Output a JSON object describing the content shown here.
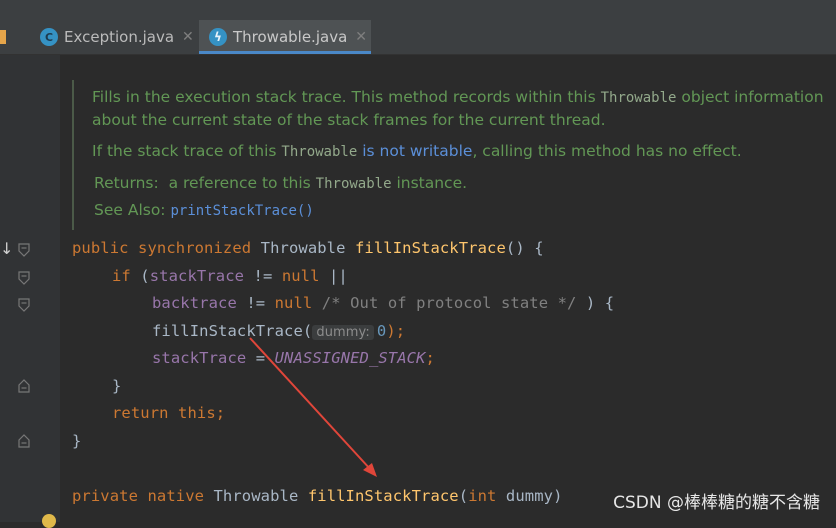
{
  "tabs": [
    {
      "label": "Exception.java",
      "icon": "class-c-icon",
      "active": false
    },
    {
      "label": "Throwable.java",
      "icon": "lightning-icon",
      "active": true
    }
  ],
  "doc": {
    "line1_pre": "Fills in the execution stack trace. This method records within this ",
    "line1_code": "Throwable",
    "line1_post": " object information",
    "line2": "about the current state of the stack frames for the current thread.",
    "line3_pre": "If the stack trace of this ",
    "line3_code": "Throwable",
    "line3_link": "is not writable",
    "line3_post": ", calling this method has no effect.",
    "returns_label": "Returns:",
    "returns_pre": "a reference to this ",
    "returns_code": "Throwable",
    "returns_post": " instance.",
    "seealso_label": "See Also:",
    "seealso_link": "printStackTrace()"
  },
  "code": {
    "l1_kw1": "public",
    "l1_kw2": "synchronized",
    "l1_type": "Throwable",
    "l1_fn": "fillInStackTrace",
    "l1_rest": "() {",
    "l2_kw": "if",
    "l2_a": " (",
    "l2_fld": "stackTrace",
    "l2_op": " != ",
    "l2_null": "null",
    "l2_end": " ||",
    "l3_fld": "backtrace",
    "l3_op": " != ",
    "l3_null": "null",
    "l3_cmt": " /* Out of protocol state */",
    "l3_end": " ) {",
    "l4_fn": "fillInStackTrace(",
    "l4_hint": "dummy:",
    "l4_num": "0",
    "l4_end": ");",
    "l5_fld": "stackTrace",
    "l5_op": " = ",
    "l5_const": "UNASSIGNED_STACK",
    "l5_end": ";",
    "l6": "}",
    "l7_kw": "return this;",
    "l8": "}",
    "l9_kw1": "private",
    "l9_kw2": "native",
    "l9_type": "Throwable",
    "l9_fn": "fillInStackTrace",
    "l9_a": "(",
    "l9_kw3": "int",
    "l9_param": " dummy)"
  },
  "watermark": "CSDN @棒棒糖的糖不含糖",
  "colors": {
    "keyword": "#cc7832",
    "function": "#ffc66d",
    "field": "#9876aa",
    "doc": "#629755",
    "arrow": "#e0463a"
  }
}
